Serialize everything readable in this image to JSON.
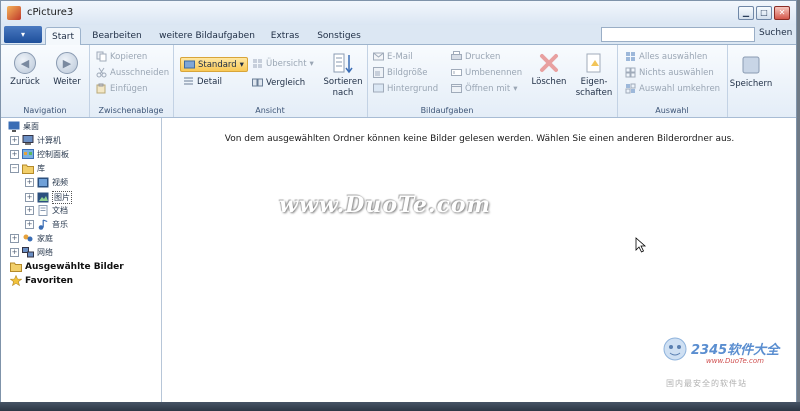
{
  "window": {
    "title": "cPicture3"
  },
  "tabs": [
    "Start",
    "Bearbeiten",
    "weitere Bildaufgaben",
    "Extras",
    "Sonstiges"
  ],
  "active_tab": "Start",
  "search": {
    "value": "",
    "label": "Suchen"
  },
  "ribbon": {
    "navigation": {
      "back": "Zurück",
      "forward": "Weiter",
      "group_label": "Navigation"
    },
    "clipboard": {
      "copy": "Kopieren",
      "cut": "Ausschneiden",
      "paste": "Einfügen",
      "group_label": "Zwischenablage"
    },
    "view": {
      "standard": "Standard",
      "detail": "Detail",
      "overview": "Übersicht",
      "compare": "Vergleich",
      "sort_line1": "Sortieren",
      "sort_line2": "nach",
      "group_label": "Ansicht"
    },
    "image_tasks": {
      "email": "E-Mail",
      "image_size": "Bildgröße",
      "background": "Hintergrund",
      "print": "Drucken",
      "rename": "Umbenennen",
      "open_with": "Öffnen mit",
      "delete": "Löschen",
      "properties_line1": "Eigen-",
      "properties_line2": "schaften",
      "group_label": "Bildaufgaben"
    },
    "selection": {
      "select_all": "Alles auswählen",
      "select_none": "Nichts auswählen",
      "invert": "Auswahl umkehren",
      "save": "Speichern",
      "group_label": "Auswahl"
    }
  },
  "tree": {
    "desktop": "桌面",
    "computer": "计算机",
    "control_panel": "控制面板",
    "library": "库",
    "videos": "视频",
    "pictures": "图片",
    "documents": "文档",
    "music": "音乐",
    "homegroup": "家庭",
    "network": "网络",
    "selected_images": "Ausgewählte Bilder",
    "favorites": "Favoriten"
  },
  "content": {
    "message": "Von dem ausgewählten Ordner können keine Bilder gelesen werden. Wählen Sie einen anderen Bilderordner aus."
  },
  "watermarks": {
    "duote": "www.DuoTe.com",
    "logo_2345": "2345软件大全",
    "logo_url": "www.DuoTe.com",
    "logo_sub": "国内最安全的软件站"
  }
}
